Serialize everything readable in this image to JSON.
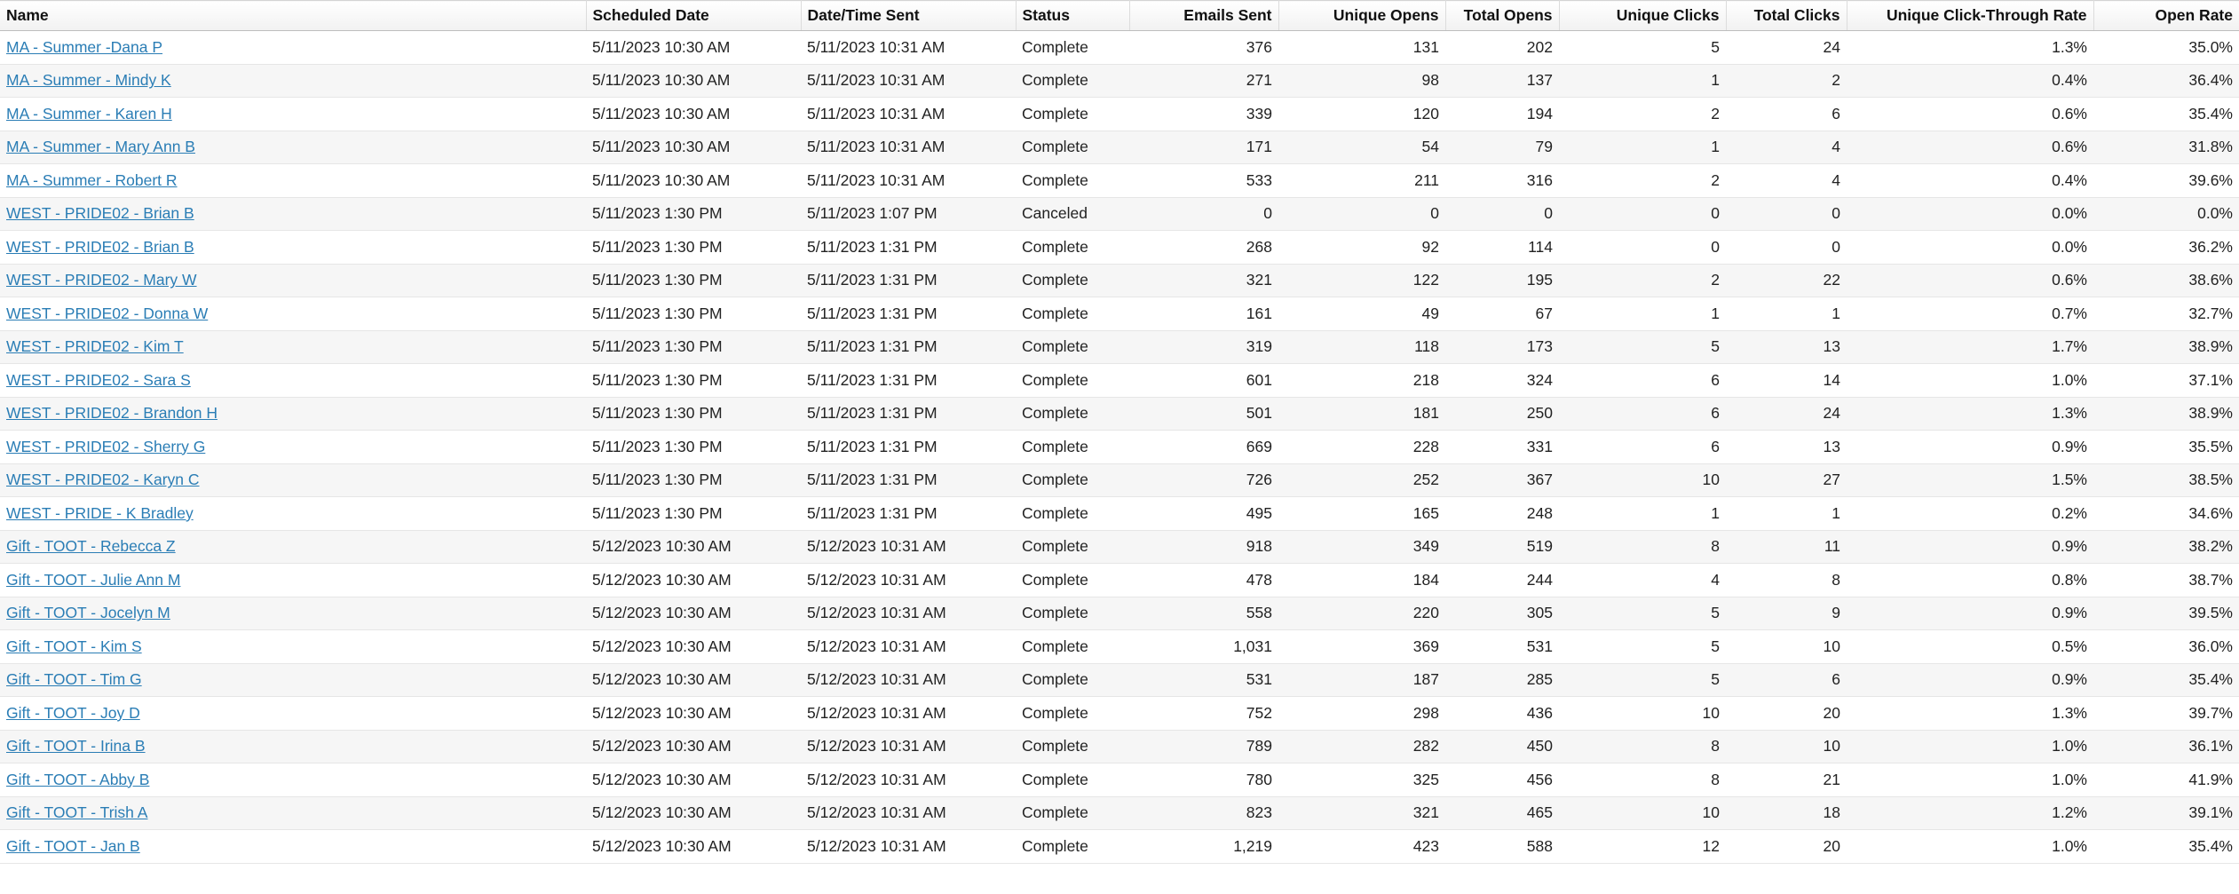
{
  "table": {
    "columns": [
      {
        "key": "name",
        "label": "Name",
        "align": "left"
      },
      {
        "key": "scheduled",
        "label": "Scheduled Date",
        "align": "left"
      },
      {
        "key": "sent_at",
        "label": "Date/Time Sent",
        "align": "left"
      },
      {
        "key": "status",
        "label": "Status",
        "align": "left"
      },
      {
        "key": "emails_sent",
        "label": "Emails Sent",
        "align": "right"
      },
      {
        "key": "unique_opens",
        "label": "Unique Opens",
        "align": "right"
      },
      {
        "key": "total_opens",
        "label": "Total Opens",
        "align": "right"
      },
      {
        "key": "unique_clicks",
        "label": "Unique Clicks",
        "align": "right"
      },
      {
        "key": "total_clicks",
        "label": "Total Clicks",
        "align": "right"
      },
      {
        "key": "uctr",
        "label": "Unique Click-Through Rate",
        "align": "right"
      },
      {
        "key": "open_rate",
        "label": "Open Rate",
        "align": "right"
      }
    ],
    "rows": [
      {
        "name": "MA - Summer -Dana P",
        "scheduled": "5/11/2023 10:30 AM",
        "sent_at": "5/11/2023 10:31 AM",
        "status": "Complete",
        "emails_sent": "376",
        "unique_opens": "131",
        "total_opens": "202",
        "unique_clicks": "5",
        "total_clicks": "24",
        "uctr": "1.3%",
        "open_rate": "35.0%"
      },
      {
        "name": "MA - Summer - Mindy K",
        "scheduled": "5/11/2023 10:30 AM",
        "sent_at": "5/11/2023 10:31 AM",
        "status": "Complete",
        "emails_sent": "271",
        "unique_opens": "98",
        "total_opens": "137",
        "unique_clicks": "1",
        "total_clicks": "2",
        "uctr": "0.4%",
        "open_rate": "36.4%"
      },
      {
        "name": "MA - Summer - Karen H",
        "scheduled": "5/11/2023 10:30 AM",
        "sent_at": "5/11/2023 10:31 AM",
        "status": "Complete",
        "emails_sent": "339",
        "unique_opens": "120",
        "total_opens": "194",
        "unique_clicks": "2",
        "total_clicks": "6",
        "uctr": "0.6%",
        "open_rate": "35.4%"
      },
      {
        "name": "MA - Summer - Mary Ann B",
        "scheduled": "5/11/2023 10:30 AM",
        "sent_at": "5/11/2023 10:31 AM",
        "status": "Complete",
        "emails_sent": "171",
        "unique_opens": "54",
        "total_opens": "79",
        "unique_clicks": "1",
        "total_clicks": "4",
        "uctr": "0.6%",
        "open_rate": "31.8%"
      },
      {
        "name": "MA - Summer - Robert R",
        "scheduled": "5/11/2023 10:30 AM",
        "sent_at": "5/11/2023 10:31 AM",
        "status": "Complete",
        "emails_sent": "533",
        "unique_opens": "211",
        "total_opens": "316",
        "unique_clicks": "2",
        "total_clicks": "4",
        "uctr": "0.4%",
        "open_rate": "39.6%"
      },
      {
        "name": "WEST - PRIDE02 - Brian B",
        "scheduled": "5/11/2023 1:30 PM",
        "sent_at": "5/11/2023 1:07 PM",
        "status": "Canceled",
        "emails_sent": "0",
        "unique_opens": "0",
        "total_opens": "0",
        "unique_clicks": "0",
        "total_clicks": "0",
        "uctr": "0.0%",
        "open_rate": "0.0%"
      },
      {
        "name": "WEST - PRIDE02 - Brian B",
        "scheduled": "5/11/2023 1:30 PM",
        "sent_at": "5/11/2023 1:31 PM",
        "status": "Complete",
        "emails_sent": "268",
        "unique_opens": "92",
        "total_opens": "114",
        "unique_clicks": "0",
        "total_clicks": "0",
        "uctr": "0.0%",
        "open_rate": "36.2%"
      },
      {
        "name": "WEST - PRIDE02 - Mary W",
        "scheduled": "5/11/2023 1:30 PM",
        "sent_at": "5/11/2023 1:31 PM",
        "status": "Complete",
        "emails_sent": "321",
        "unique_opens": "122",
        "total_opens": "195",
        "unique_clicks": "2",
        "total_clicks": "22",
        "uctr": "0.6%",
        "open_rate": "38.6%"
      },
      {
        "name": "WEST - PRIDE02 - Donna W",
        "scheduled": "5/11/2023 1:30 PM",
        "sent_at": "5/11/2023 1:31 PM",
        "status": "Complete",
        "emails_sent": "161",
        "unique_opens": "49",
        "total_opens": "67",
        "unique_clicks": "1",
        "total_clicks": "1",
        "uctr": "0.7%",
        "open_rate": "32.7%"
      },
      {
        "name": "WEST - PRIDE02 - Kim T",
        "scheduled": "5/11/2023 1:30 PM",
        "sent_at": "5/11/2023 1:31 PM",
        "status": "Complete",
        "emails_sent": "319",
        "unique_opens": "118",
        "total_opens": "173",
        "unique_clicks": "5",
        "total_clicks": "13",
        "uctr": "1.7%",
        "open_rate": "38.9%"
      },
      {
        "name": "WEST - PRIDE02 - Sara S",
        "scheduled": "5/11/2023 1:30 PM",
        "sent_at": "5/11/2023 1:31 PM",
        "status": "Complete",
        "emails_sent": "601",
        "unique_opens": "218",
        "total_opens": "324",
        "unique_clicks": "6",
        "total_clicks": "14",
        "uctr": "1.0%",
        "open_rate": "37.1%"
      },
      {
        "name": "WEST - PRIDE02 - Brandon H",
        "scheduled": "5/11/2023 1:30 PM",
        "sent_at": "5/11/2023 1:31 PM",
        "status": "Complete",
        "emails_sent": "501",
        "unique_opens": "181",
        "total_opens": "250",
        "unique_clicks": "6",
        "total_clicks": "24",
        "uctr": "1.3%",
        "open_rate": "38.9%"
      },
      {
        "name": "WEST - PRIDE02 - Sherry G",
        "scheduled": "5/11/2023 1:30 PM",
        "sent_at": "5/11/2023 1:31 PM",
        "status": "Complete",
        "emails_sent": "669",
        "unique_opens": "228",
        "total_opens": "331",
        "unique_clicks": "6",
        "total_clicks": "13",
        "uctr": "0.9%",
        "open_rate": "35.5%"
      },
      {
        "name": "WEST - PRIDE02 - Karyn C",
        "scheduled": "5/11/2023 1:30 PM",
        "sent_at": "5/11/2023 1:31 PM",
        "status": "Complete",
        "emails_sent": "726",
        "unique_opens": "252",
        "total_opens": "367",
        "unique_clicks": "10",
        "total_clicks": "27",
        "uctr": "1.5%",
        "open_rate": "38.5%"
      },
      {
        "name": "WEST - PRIDE - K Bradley",
        "scheduled": "5/11/2023 1:30 PM",
        "sent_at": "5/11/2023 1:31 PM",
        "status": "Complete",
        "emails_sent": "495",
        "unique_opens": "165",
        "total_opens": "248",
        "unique_clicks": "1",
        "total_clicks": "1",
        "uctr": "0.2%",
        "open_rate": "34.6%"
      },
      {
        "name": "Gift - TOOT - Rebecca Z",
        "scheduled": "5/12/2023 10:30 AM",
        "sent_at": "5/12/2023 10:31 AM",
        "status": "Complete",
        "emails_sent": "918",
        "unique_opens": "349",
        "total_opens": "519",
        "unique_clicks": "8",
        "total_clicks": "11",
        "uctr": "0.9%",
        "open_rate": "38.2%"
      },
      {
        "name": "Gift - TOOT - Julie Ann M",
        "scheduled": "5/12/2023 10:30 AM",
        "sent_at": "5/12/2023 10:31 AM",
        "status": "Complete",
        "emails_sent": "478",
        "unique_opens": "184",
        "total_opens": "244",
        "unique_clicks": "4",
        "total_clicks": "8",
        "uctr": "0.8%",
        "open_rate": "38.7%"
      },
      {
        "name": "Gift - TOOT - Jocelyn M",
        "scheduled": "5/12/2023 10:30 AM",
        "sent_at": "5/12/2023 10:31 AM",
        "status": "Complete",
        "emails_sent": "558",
        "unique_opens": "220",
        "total_opens": "305",
        "unique_clicks": "5",
        "total_clicks": "9",
        "uctr": "0.9%",
        "open_rate": "39.5%"
      },
      {
        "name": "Gift - TOOT - Kim S",
        "scheduled": "5/12/2023 10:30 AM",
        "sent_at": "5/12/2023 10:31 AM",
        "status": "Complete",
        "emails_sent": "1,031",
        "unique_opens": "369",
        "total_opens": "531",
        "unique_clicks": "5",
        "total_clicks": "10",
        "uctr": "0.5%",
        "open_rate": "36.0%"
      },
      {
        "name": "Gift - TOOT - Tim G",
        "scheduled": "5/12/2023 10:30 AM",
        "sent_at": "5/12/2023 10:31 AM",
        "status": "Complete",
        "emails_sent": "531",
        "unique_opens": "187",
        "total_opens": "285",
        "unique_clicks": "5",
        "total_clicks": "6",
        "uctr": "0.9%",
        "open_rate": "35.4%"
      },
      {
        "name": "Gift - TOOT - Joy D",
        "scheduled": "5/12/2023 10:30 AM",
        "sent_at": "5/12/2023 10:31 AM",
        "status": "Complete",
        "emails_sent": "752",
        "unique_opens": "298",
        "total_opens": "436",
        "unique_clicks": "10",
        "total_clicks": "20",
        "uctr": "1.3%",
        "open_rate": "39.7%"
      },
      {
        "name": "Gift - TOOT - Irina B",
        "scheduled": "5/12/2023 10:30 AM",
        "sent_at": "5/12/2023 10:31 AM",
        "status": "Complete",
        "emails_sent": "789",
        "unique_opens": "282",
        "total_opens": "450",
        "unique_clicks": "8",
        "total_clicks": "10",
        "uctr": "1.0%",
        "open_rate": "36.1%"
      },
      {
        "name": "Gift - TOOT - Abby B",
        "scheduled": "5/12/2023 10:30 AM",
        "sent_at": "5/12/2023 10:31 AM",
        "status": "Complete",
        "emails_sent": "780",
        "unique_opens": "325",
        "total_opens": "456",
        "unique_clicks": "8",
        "total_clicks": "21",
        "uctr": "1.0%",
        "open_rate": "41.9%"
      },
      {
        "name": "Gift - TOOT - Trish A",
        "scheduled": "5/12/2023 10:30 AM",
        "sent_at": "5/12/2023 10:31 AM",
        "status": "Complete",
        "emails_sent": "823",
        "unique_opens": "321",
        "total_opens": "465",
        "unique_clicks": "10",
        "total_clicks": "18",
        "uctr": "1.2%",
        "open_rate": "39.1%"
      },
      {
        "name": "Gift - TOOT - Jan B",
        "scheduled": "5/12/2023 10:30 AM",
        "sent_at": "5/12/2023 10:31 AM",
        "status": "Complete",
        "emails_sent": "1,219",
        "unique_opens": "423",
        "total_opens": "588",
        "unique_clicks": "12",
        "total_clicks": "20",
        "uctr": "1.0%",
        "open_rate": "35.4%"
      }
    ]
  },
  "colors": {
    "link": "#2a7db5",
    "row_alt": "#f6f6f6",
    "header_bg": "#f1f1f1"
  }
}
